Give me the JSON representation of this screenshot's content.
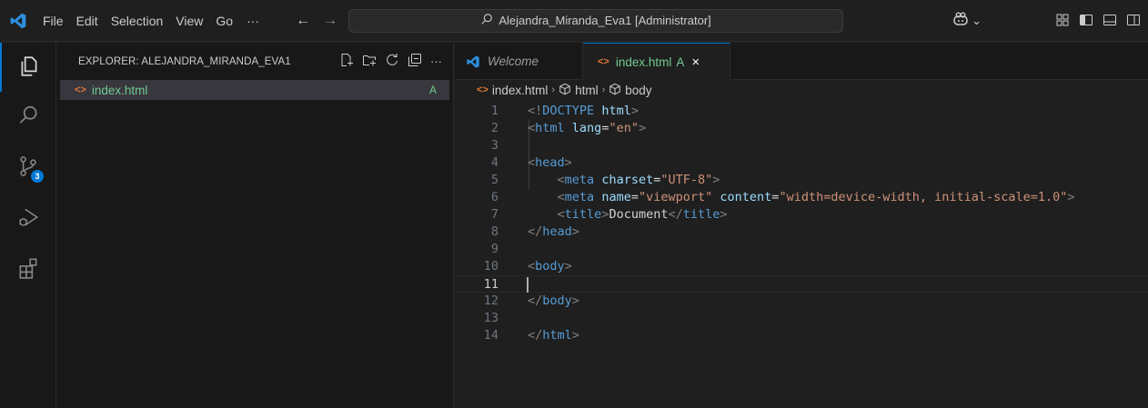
{
  "menu": {
    "items": [
      "File",
      "Edit",
      "Selection",
      "View",
      "Go"
    ],
    "more": "···",
    "back": "←",
    "forward": "→"
  },
  "command_center": {
    "text": "Alejandra_Miranda_Eva1 [Administrator]"
  },
  "copilot": {
    "caret": "⌄"
  },
  "activity_bar": {
    "source_control_badge": "3"
  },
  "sidebar": {
    "header": "EXPLORER: ALEJANDRA_MIRANDA_EVA1",
    "more": "···",
    "files": [
      {
        "name": "index.html",
        "status": "A"
      }
    ]
  },
  "tabs": [
    {
      "label": "Welcome"
    },
    {
      "label": "index.html",
      "status": "A",
      "close": "×"
    }
  ],
  "breadcrumb": {
    "file": "index.html",
    "sep": "›",
    "node1": "html",
    "node2": "body"
  },
  "editor": {
    "lines": [
      {
        "n": "1",
        "tokens": [
          [
            "br",
            "<!"
          ],
          [
            "tag",
            "DOCTYPE"
          ],
          [
            "txt",
            " "
          ],
          [
            "attr",
            "html"
          ],
          [
            "br",
            ">"
          ]
        ]
      },
      {
        "n": "2",
        "tokens": [
          [
            "br",
            "<"
          ],
          [
            "tag",
            "html"
          ],
          [
            "txt",
            " "
          ],
          [
            "attr",
            "lang"
          ],
          [
            "txt",
            "="
          ],
          [
            "str",
            "\"en\""
          ],
          [
            "br",
            ">"
          ]
        ]
      },
      {
        "n": "3",
        "tokens": []
      },
      {
        "n": "4",
        "tokens": [
          [
            "br",
            "<"
          ],
          [
            "tag",
            "head"
          ],
          [
            "br",
            ">"
          ]
        ]
      },
      {
        "n": "5",
        "tokens": [
          [
            "txt",
            "    "
          ],
          [
            "br",
            "<"
          ],
          [
            "tag",
            "meta"
          ],
          [
            "txt",
            " "
          ],
          [
            "attr",
            "charset"
          ],
          [
            "txt",
            "="
          ],
          [
            "str",
            "\"UTF-8\""
          ],
          [
            "br",
            ">"
          ]
        ]
      },
      {
        "n": "6",
        "tokens": [
          [
            "txt",
            "    "
          ],
          [
            "br",
            "<"
          ],
          [
            "tag",
            "meta"
          ],
          [
            "txt",
            " "
          ],
          [
            "attr",
            "name"
          ],
          [
            "txt",
            "="
          ],
          [
            "str",
            "\"viewport\""
          ],
          [
            "txt",
            " "
          ],
          [
            "attr",
            "content"
          ],
          [
            "txt",
            "="
          ],
          [
            "str",
            "\"width=device-width, initial-scale=1.0\""
          ],
          [
            "br",
            ">"
          ]
        ]
      },
      {
        "n": "7",
        "tokens": [
          [
            "txt",
            "    "
          ],
          [
            "br",
            "<"
          ],
          [
            "tag",
            "title"
          ],
          [
            "br",
            ">"
          ],
          [
            "txt",
            "Document"
          ],
          [
            "br",
            "</"
          ],
          [
            "tag",
            "title"
          ],
          [
            "br",
            ">"
          ]
        ]
      },
      {
        "n": "8",
        "tokens": [
          [
            "br",
            "</"
          ],
          [
            "tag",
            "head"
          ],
          [
            "br",
            ">"
          ]
        ]
      },
      {
        "n": "9",
        "tokens": []
      },
      {
        "n": "10",
        "tokens": [
          [
            "br",
            "<"
          ],
          [
            "tag",
            "body"
          ],
          [
            "br",
            ">"
          ]
        ]
      },
      {
        "n": "11",
        "tokens": [],
        "current": true
      },
      {
        "n": "12",
        "tokens": [
          [
            "br",
            "</"
          ],
          [
            "tag",
            "body"
          ],
          [
            "br",
            ">"
          ]
        ]
      },
      {
        "n": "13",
        "tokens": []
      },
      {
        "n": "14",
        "tokens": [
          [
            "br",
            "</"
          ],
          [
            "tag",
            "html"
          ],
          [
            "br",
            ">"
          ]
        ]
      }
    ]
  }
}
